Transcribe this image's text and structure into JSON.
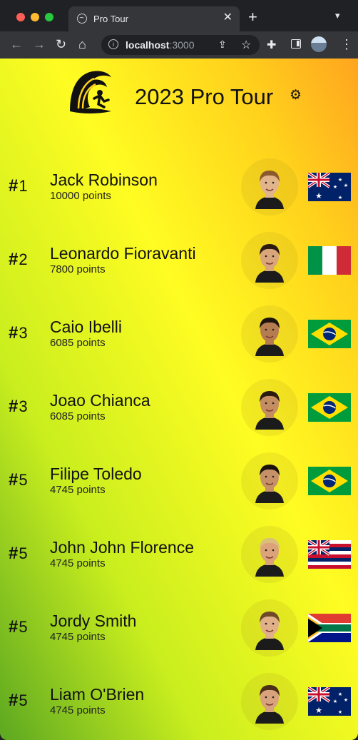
{
  "browser": {
    "tab_title": "Pro Tour",
    "address_host": "localhost",
    "address_port": ":3000"
  },
  "header": {
    "title": "2023 Pro Tour"
  },
  "surfers": [
    {
      "rank": "1",
      "name": "Jack Robinson",
      "points": "10000 points",
      "flag": "australia",
      "hair": "#8a5a2c",
      "skin": "#e2b48c"
    },
    {
      "rank": "2",
      "name": "Leonardo Fioravanti",
      "points": "7800 points",
      "flag": "italy",
      "hair": "#2b1a10",
      "skin": "#d9a57a"
    },
    {
      "rank": "3",
      "name": "Caio Ibelli",
      "points": "6085 points",
      "flag": "brazil",
      "hair": "#1e140e",
      "skin": "#b57c52"
    },
    {
      "rank": "3",
      "name": "Joao Chianca",
      "points": "6085 points",
      "flag": "brazil",
      "hair": "#2a1a10",
      "skin": "#c48d62"
    },
    {
      "rank": "5",
      "name": "Filipe Toledo",
      "points": "4745 points",
      "flag": "brazil",
      "hair": "#1a120c",
      "skin": "#c69168"
    },
    {
      "rank": "5",
      "name": "John John Florence",
      "points": "4745 points",
      "flag": "hawaii",
      "hair": "#d9bf7a",
      "skin": "#dca37a"
    },
    {
      "rank": "5",
      "name": "Jordy Smith",
      "points": "4745 points",
      "flag": "south-africa",
      "hair": "#6e4a2a",
      "skin": "#e0b088"
    },
    {
      "rank": "5",
      "name": "Liam O'Brien",
      "points": "4745 points",
      "flag": "australia",
      "hair": "#4a2e18",
      "skin": "#d8a27c"
    }
  ]
}
